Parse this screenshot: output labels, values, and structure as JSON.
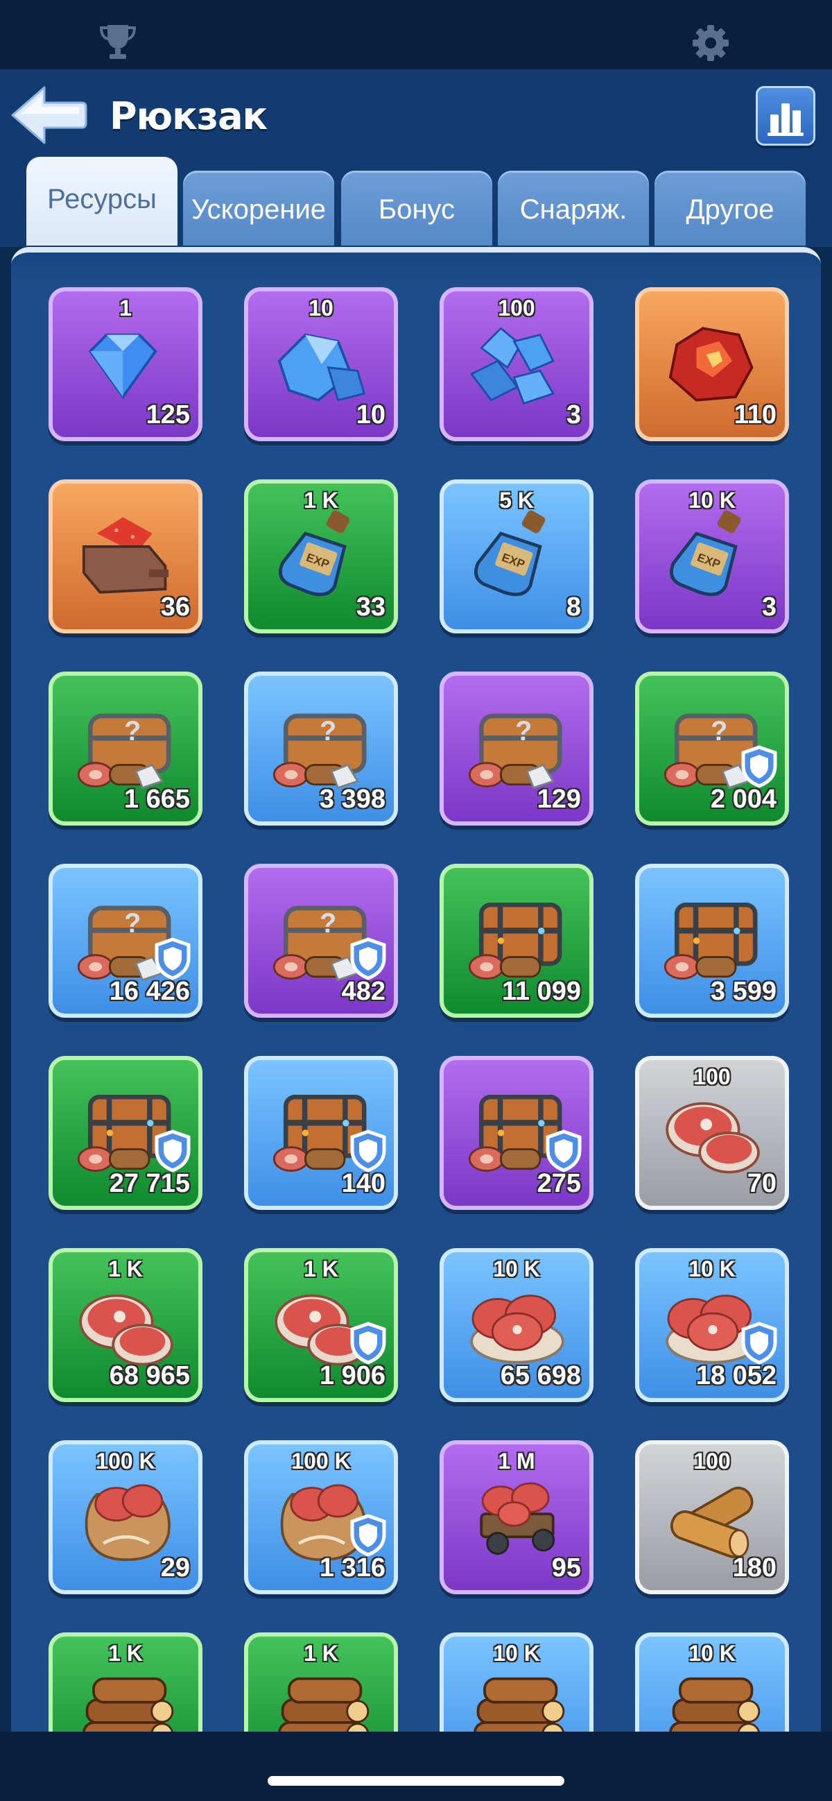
{
  "header": {
    "title": "Рюкзак"
  },
  "tabs": [
    {
      "label": "Ресурсы",
      "active": true
    },
    {
      "label": "Ускорение",
      "active": false
    },
    {
      "label": "Бонус",
      "active": false
    },
    {
      "label": "Снаряж.",
      "active": false
    },
    {
      "label": "Другое",
      "active": false
    }
  ],
  "icons": {
    "top_left": "trophy-icon",
    "top_right": "gear-icon",
    "back": "back-arrow-icon",
    "stats": "bar-chart-icon"
  },
  "colors": {
    "purple": "#9450db",
    "orange": "#e58645",
    "green": "#2aa646",
    "blue": "#5aa8f4",
    "gray": "#b5b8bd"
  },
  "items": [
    {
      "icon": "diamond-icon",
      "rarity": "purple",
      "tier": "1",
      "count": "125",
      "shield": false
    },
    {
      "icon": "diamond-pile-icon",
      "rarity": "purple",
      "tier": "10",
      "count": "10",
      "shield": false
    },
    {
      "icon": "diamond-heap-icon",
      "rarity": "purple",
      "tier": "100",
      "count": "3",
      "shield": false
    },
    {
      "icon": "red-ore-icon",
      "rarity": "orange",
      "tier": "",
      "count": "110",
      "shield": false
    },
    {
      "icon": "ore-cart-icon",
      "rarity": "orange",
      "tier": "",
      "count": "36",
      "shield": false
    },
    {
      "icon": "exp-potion-icon",
      "rarity": "green",
      "tier": "1 K",
      "count": "33",
      "shield": false
    },
    {
      "icon": "exp-potion-icon",
      "rarity": "blue",
      "tier": "5 K",
      "count": "8",
      "shield": false
    },
    {
      "icon": "exp-potion-icon",
      "rarity": "purple",
      "tier": "10 K",
      "count": "3",
      "shield": false
    },
    {
      "icon": "mystery-chest-icon",
      "rarity": "green",
      "tier": "",
      "count": "1 665",
      "shield": false
    },
    {
      "icon": "mystery-chest-icon",
      "rarity": "blue",
      "tier": "",
      "count": "3 398",
      "shield": false
    },
    {
      "icon": "mystery-chest-icon",
      "rarity": "purple",
      "tier": "",
      "count": "129",
      "shield": false
    },
    {
      "icon": "mystery-chest-icon",
      "rarity": "green",
      "tier": "",
      "count": "2 004",
      "shield": true
    },
    {
      "icon": "mystery-chest-icon",
      "rarity": "blue",
      "tier": "",
      "count": "16 426",
      "shield": true
    },
    {
      "icon": "mystery-chest-icon",
      "rarity": "purple",
      "tier": "",
      "count": "482",
      "shield": true
    },
    {
      "icon": "supply-chest-icon",
      "rarity": "green",
      "tier": "",
      "count": "11 099",
      "shield": false
    },
    {
      "icon": "supply-chest-icon",
      "rarity": "blue",
      "tier": "",
      "count": "3 599",
      "shield": false
    },
    {
      "icon": "supply-chest-icon",
      "rarity": "green",
      "tier": "",
      "count": "27 715",
      "shield": true
    },
    {
      "icon": "supply-chest-icon",
      "rarity": "blue",
      "tier": "",
      "count": "140",
      "shield": true
    },
    {
      "icon": "supply-chest-icon",
      "rarity": "purple",
      "tier": "",
      "count": "275",
      "shield": true
    },
    {
      "icon": "meat-icon",
      "rarity": "gray",
      "tier": "100",
      "count": "70",
      "shield": false
    },
    {
      "icon": "meat-icon",
      "rarity": "green",
      "tier": "1 K",
      "count": "68 965",
      "shield": false
    },
    {
      "icon": "meat-icon",
      "rarity": "green",
      "tier": "1 K",
      "count": "1 906",
      "shield": true
    },
    {
      "icon": "meat-plate-icon",
      "rarity": "blue",
      "tier": "10 K",
      "count": "65 698",
      "shield": false
    },
    {
      "icon": "meat-plate-icon",
      "rarity": "blue",
      "tier": "10 K",
      "count": "18 052",
      "shield": true
    },
    {
      "icon": "meat-sack-icon",
      "rarity": "blue",
      "tier": "100 K",
      "count": "29",
      "shield": false
    },
    {
      "icon": "meat-sack-icon",
      "rarity": "blue",
      "tier": "100 K",
      "count": "1 316",
      "shield": true
    },
    {
      "icon": "meat-cart-icon",
      "rarity": "purple",
      "tier": "1 M",
      "count": "95",
      "shield": false
    },
    {
      "icon": "wood-icon",
      "rarity": "gray",
      "tier": "100",
      "count": "180",
      "shield": false
    },
    {
      "icon": "wood-pile-icon",
      "rarity": "green",
      "tier": "1 K",
      "count": "",
      "shield": false
    },
    {
      "icon": "wood-pile-icon",
      "rarity": "green",
      "tier": "1 K",
      "count": "",
      "shield": false
    },
    {
      "icon": "wood-pile-icon",
      "rarity": "blue",
      "tier": "10 K",
      "count": "",
      "shield": false
    },
    {
      "icon": "wood-pile-icon",
      "rarity": "blue",
      "tier": "10 K",
      "count": "",
      "shield": false
    }
  ]
}
